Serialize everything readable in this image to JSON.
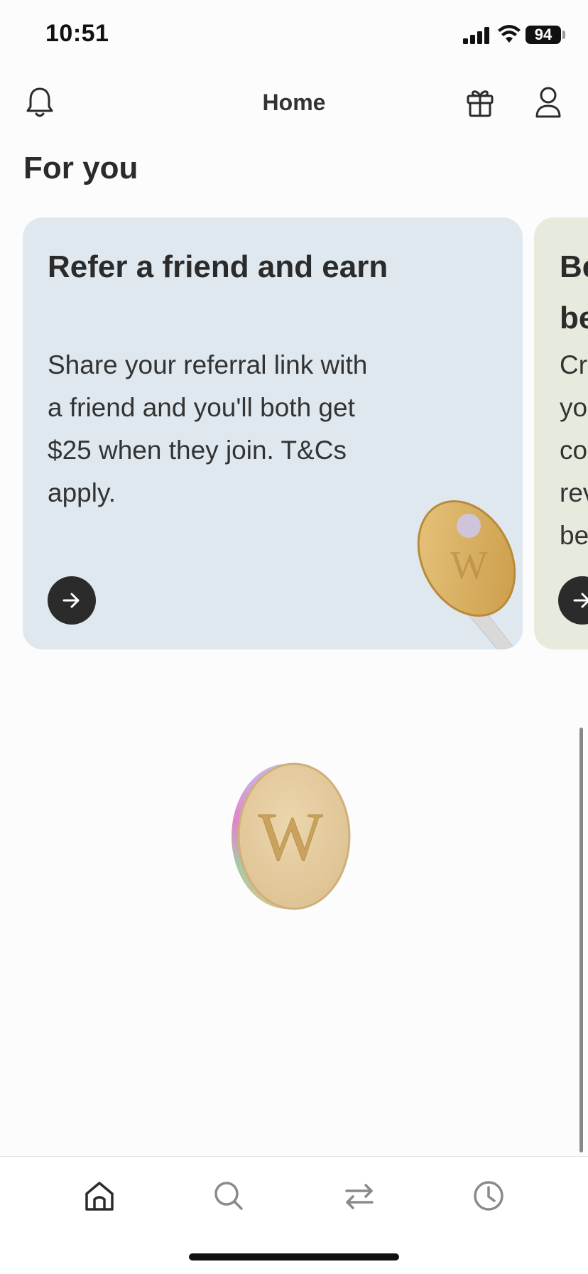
{
  "status_bar": {
    "time": "10:51",
    "battery": "94"
  },
  "header": {
    "title": "Home"
  },
  "section": {
    "title": "For you"
  },
  "cards": [
    {
      "title": "Refer a friend and earn",
      "body": "Share your referral link with a friend and you'll both get $25 when they join. T&Cs apply."
    },
    {
      "title_partial": "Be\nbe",
      "body_partial": "Cr\nyo\nco\nrev\nbe"
    }
  ],
  "colors": {
    "card_1_bg": "#dfe8ef",
    "card_2_bg": "#e7ebdd",
    "text": "#2b2b2b",
    "accent_gold": "#e2c89c"
  },
  "icons": {
    "bell": "bell-icon",
    "gift": "gift-icon",
    "profile": "profile-icon",
    "arrow": "arrow-right-icon",
    "home": "home-icon",
    "search": "search-icon",
    "transfer": "transfer-icon",
    "history": "clock-icon"
  },
  "tabs": [
    {
      "name": "home",
      "active": true
    },
    {
      "name": "search",
      "active": false
    },
    {
      "name": "transfer",
      "active": false
    },
    {
      "name": "history",
      "active": false
    }
  ]
}
